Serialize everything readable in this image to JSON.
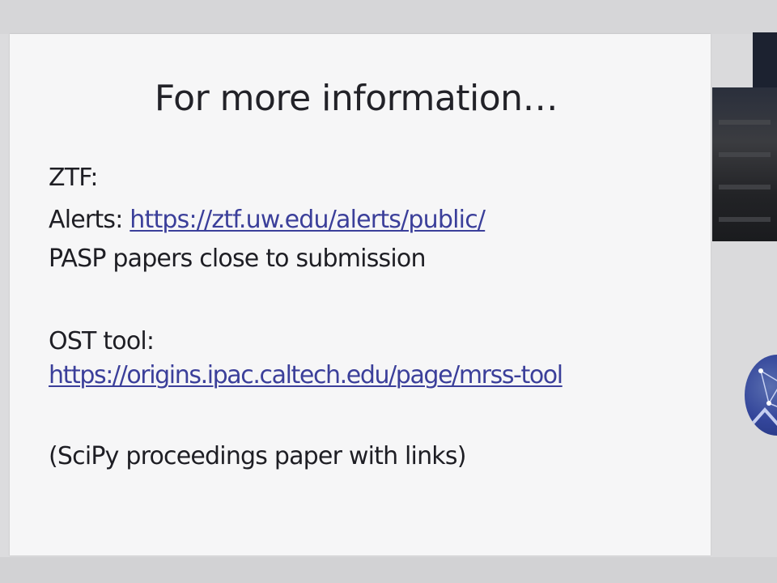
{
  "slide": {
    "title": "For more information…",
    "lines": {
      "ztf_heading": "ZTF:",
      "alerts_label": "Alerts: ",
      "alerts_link": "https://ztf.uw.edu/alerts/public/",
      "pasp_note": "PASP papers close to submission",
      "ost_heading": "OST tool:",
      "ost_link": "https://origins.ipac.caltech.edu/page/mrss-tool",
      "scipy_note": "(SciPy proceedings paper with links)"
    }
  },
  "icons": {
    "logo": "circular-network-logo-icon",
    "photo": "room-photo-thumbnail"
  },
  "colors": {
    "slide_background": "#f6f6f7",
    "text": "#1e1e24",
    "link": "#3b3f9a",
    "logo": "#33459a"
  }
}
